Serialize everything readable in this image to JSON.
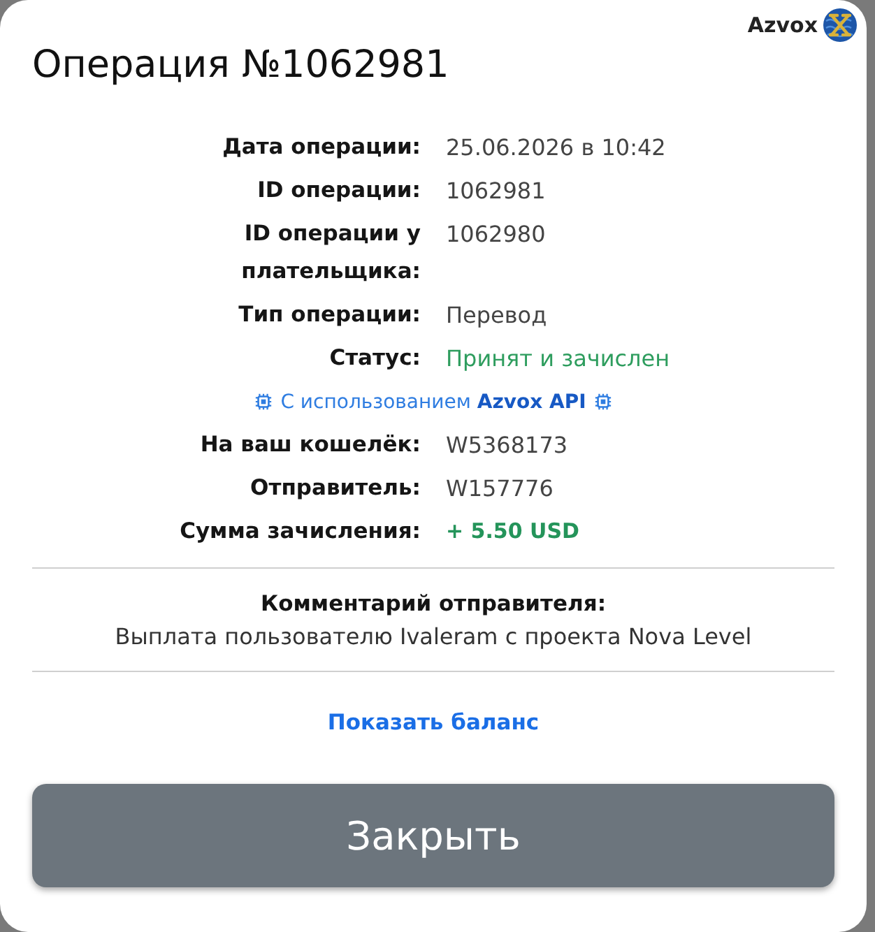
{
  "header": {
    "brand": "Azvox",
    "title": "Операция №1062981"
  },
  "details": [
    {
      "kind": "field",
      "label": "Дата операции:",
      "value": "25.06.2026 в 10:42"
    },
    {
      "kind": "field",
      "label": "ID операции:",
      "value": "1062981"
    },
    {
      "kind": "field",
      "label": "ID операции у плательщика:",
      "value": "1062980"
    },
    {
      "kind": "field",
      "label": "Тип операции:",
      "value": "Перевод"
    },
    {
      "kind": "status",
      "label": "Статус:",
      "value": "Принят и зачислен"
    },
    {
      "kind": "note",
      "text": "С использованием **Azvox API**"
    },
    {
      "kind": "field",
      "label": "На ваш кошелёк:",
      "value": "W5368173"
    },
    {
      "kind": "field",
      "label": "Отправитель:",
      "value": "W157776"
    },
    {
      "kind": "amount",
      "label": "Сумма зачисления:",
      "value": "+ 5.50 USD"
    }
  ],
  "comment": {
    "title": "Комментарий отправителя:",
    "text": "Выплата пользователю Ivaleram с проекта Nova Level"
  },
  "link": "Показать баланс",
  "buttons": [
    {
      "label": "Закрыть"
    }
  ]
}
